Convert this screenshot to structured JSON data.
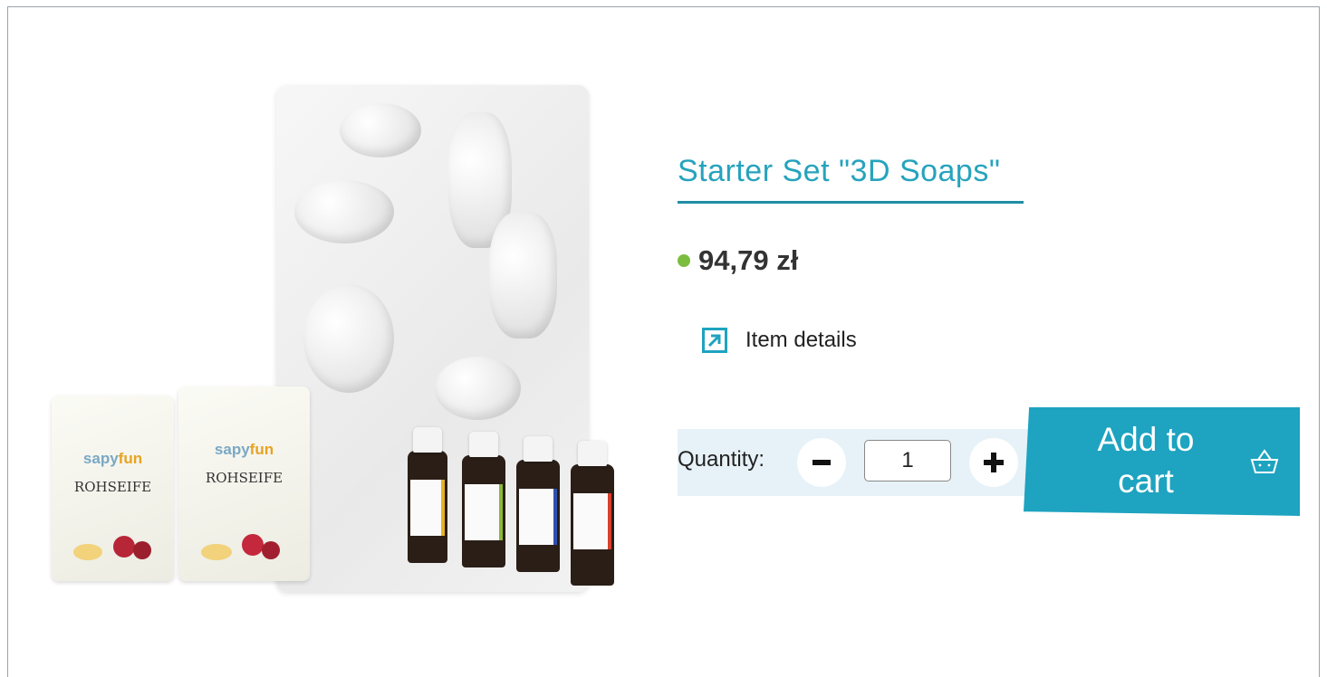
{
  "product": {
    "title": "Starter Set \"3D Soaps\"",
    "price": "94,79 zł",
    "stock_status_color": "#7cbc3e",
    "details_label": "Item details",
    "details_icon": "external-arrow-icon",
    "image": {
      "soap_brand_a": "s",
      "soap_brand_b": "apy",
      "soap_brand_c": "fun",
      "soap_name": "ROHSEIFE"
    }
  },
  "quantity": {
    "label": "Quantity:",
    "value": "1",
    "minus_icon": "minus-icon",
    "plus_icon": "plus-icon"
  },
  "cart": {
    "label": "Add to cart",
    "icon": "basket-icon",
    "color": "#1ea3c0"
  },
  "colors": {
    "title": "#26a3bd",
    "qty_band": "#e6f2f8"
  }
}
